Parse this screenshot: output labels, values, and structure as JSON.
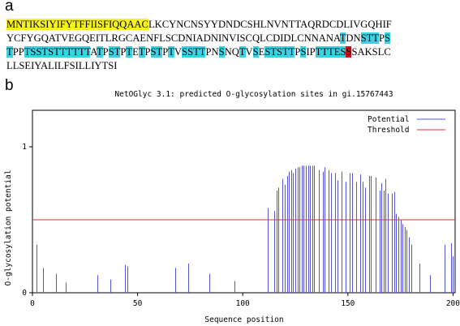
{
  "panel_a": {
    "label": "a",
    "sequence_lines": [
      [
        [
          "MNTIKSIYIFYTFFIISFIQQAAC",
          "yellow"
        ],
        [
          "LKCYNCNSYYDNDCSHLNVNTTAQRDCDLIVGQHIF",
          ""
        ]
      ],
      [
        [
          "YCFYGQATVEGQEITLRGCAENFLSCDNIADNINVISCQLCDIDLCNNANA",
          ""
        ],
        [
          "T",
          "cyan"
        ],
        [
          "DN",
          ""
        ],
        [
          "STT",
          "cyan"
        ],
        [
          "P",
          ""
        ],
        [
          "S",
          "cyan"
        ]
      ],
      [
        [
          "T",
          "cyan"
        ],
        [
          "PP",
          ""
        ],
        [
          "TSSTSTTTTTT",
          "cyan"
        ],
        [
          "A",
          ""
        ],
        [
          "T",
          "cyan"
        ],
        [
          "P",
          ""
        ],
        [
          "ST",
          "cyan"
        ],
        [
          "P",
          ""
        ],
        [
          "T",
          "cyan"
        ],
        [
          "E",
          ""
        ],
        [
          "T",
          "cyan"
        ],
        [
          "P",
          ""
        ],
        [
          "ST",
          "cyan"
        ],
        [
          "P",
          ""
        ],
        [
          "T",
          "cyan"
        ],
        [
          "V",
          ""
        ],
        [
          "SSTT",
          "cyan"
        ],
        [
          "PN",
          ""
        ],
        [
          "S",
          "cyan"
        ],
        [
          "NQ",
          ""
        ],
        [
          "T",
          "cyan"
        ],
        [
          "V",
          ""
        ],
        [
          "S",
          "cyan"
        ],
        [
          "E",
          ""
        ],
        [
          "STSTT",
          "cyan"
        ],
        [
          "P",
          ""
        ],
        [
          "S",
          "cyan"
        ],
        [
          "IP",
          ""
        ],
        [
          "TTTE",
          "cyan"
        ],
        [
          "S",
          "cyan"
        ],
        [
          "S",
          "red"
        ],
        [
          "SAKSLC",
          ""
        ]
      ],
      [
        [
          "LLSEIYALILFSILLIYTSI",
          ""
        ]
      ]
    ]
  },
  "panel_b": {
    "label": "b"
  },
  "chart_data": {
    "type": "bar",
    "title": "NetOGlyc 3.1: predicted O-glycosylation sites in gi.15767443",
    "xlabel": "Sequence position",
    "ylabel": "O-glycosylation potential",
    "xlim": [
      0,
      201
    ],
    "ylim": [
      0,
      1.25
    ],
    "xticks": [
      0,
      50,
      100,
      150,
      200
    ],
    "yticks": [
      0,
      1
    ],
    "threshold": 0.5,
    "colors": {
      "potential": "#5555dd",
      "threshold": "#e03030"
    },
    "legend": {
      "position": "top-right",
      "entries": [
        "Potential",
        "Threshold"
      ]
    },
    "series": [
      {
        "name": "Potential",
        "x": [
          2,
          5,
          11,
          16,
          31,
          37,
          44,
          45,
          68,
          74,
          84,
          96,
          112,
          115,
          116,
          117,
          119,
          120,
          121,
          122,
          123,
          124,
          125,
          126,
          127,
          128,
          129,
          130,
          131,
          132,
          133,
          134,
          136,
          138,
          139,
          141,
          142,
          144,
          145,
          147,
          149,
          151,
          152,
          154,
          156,
          157,
          158,
          160,
          161,
          163,
          165,
          166,
          167,
          168,
          169,
          171,
          172,
          173,
          174,
          175,
          176,
          177,
          178,
          179,
          180,
          184,
          189,
          196,
          199,
          200
        ],
        "y": [
          0.33,
          0.17,
          0.13,
          0.07,
          0.12,
          0.09,
          0.19,
          0.18,
          0.17,
          0.2,
          0.13,
          0.08,
          0.58,
          0.56,
          0.7,
          0.72,
          0.78,
          0.74,
          0.8,
          0.83,
          0.84,
          0.82,
          0.85,
          0.86,
          0.86,
          0.87,
          0.87,
          0.87,
          0.87,
          0.87,
          0.87,
          0.87,
          0.84,
          0.83,
          0.86,
          0.84,
          0.82,
          0.82,
          0.77,
          0.83,
          0.76,
          0.82,
          0.82,
          0.76,
          0.81,
          0.76,
          0.72,
          0.8,
          0.8,
          0.79,
          0.7,
          0.75,
          0.7,
          0.78,
          0.68,
          0.68,
          0.69,
          0.54,
          0.52,
          0.5,
          0.47,
          0.45,
          0.43,
          0.38,
          0.33,
          0.2,
          0.12,
          0.33,
          0.34,
          0.25
        ]
      }
    ]
  }
}
